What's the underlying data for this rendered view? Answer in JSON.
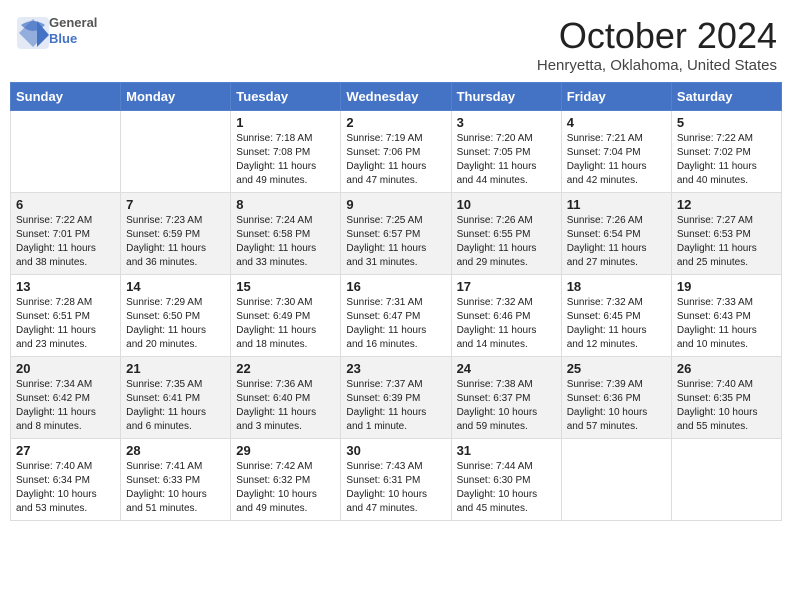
{
  "header": {
    "logo_line1": "General",
    "logo_line2": "Blue",
    "month_title": "October 2024",
    "location": "Henryetta, Oklahoma, United States"
  },
  "days_of_week": [
    "Sunday",
    "Monday",
    "Tuesday",
    "Wednesday",
    "Thursday",
    "Friday",
    "Saturday"
  ],
  "weeks": [
    [
      {
        "day": "",
        "info": ""
      },
      {
        "day": "",
        "info": ""
      },
      {
        "day": "1",
        "info": "Sunrise: 7:18 AM\nSunset: 7:08 PM\nDaylight: 11 hours and 49 minutes."
      },
      {
        "day": "2",
        "info": "Sunrise: 7:19 AM\nSunset: 7:06 PM\nDaylight: 11 hours and 47 minutes."
      },
      {
        "day": "3",
        "info": "Sunrise: 7:20 AM\nSunset: 7:05 PM\nDaylight: 11 hours and 44 minutes."
      },
      {
        "day": "4",
        "info": "Sunrise: 7:21 AM\nSunset: 7:04 PM\nDaylight: 11 hours and 42 minutes."
      },
      {
        "day": "5",
        "info": "Sunrise: 7:22 AM\nSunset: 7:02 PM\nDaylight: 11 hours and 40 minutes."
      }
    ],
    [
      {
        "day": "6",
        "info": "Sunrise: 7:22 AM\nSunset: 7:01 PM\nDaylight: 11 hours and 38 minutes."
      },
      {
        "day": "7",
        "info": "Sunrise: 7:23 AM\nSunset: 6:59 PM\nDaylight: 11 hours and 36 minutes."
      },
      {
        "day": "8",
        "info": "Sunrise: 7:24 AM\nSunset: 6:58 PM\nDaylight: 11 hours and 33 minutes."
      },
      {
        "day": "9",
        "info": "Sunrise: 7:25 AM\nSunset: 6:57 PM\nDaylight: 11 hours and 31 minutes."
      },
      {
        "day": "10",
        "info": "Sunrise: 7:26 AM\nSunset: 6:55 PM\nDaylight: 11 hours and 29 minutes."
      },
      {
        "day": "11",
        "info": "Sunrise: 7:26 AM\nSunset: 6:54 PM\nDaylight: 11 hours and 27 minutes."
      },
      {
        "day": "12",
        "info": "Sunrise: 7:27 AM\nSunset: 6:53 PM\nDaylight: 11 hours and 25 minutes."
      }
    ],
    [
      {
        "day": "13",
        "info": "Sunrise: 7:28 AM\nSunset: 6:51 PM\nDaylight: 11 hours and 23 minutes."
      },
      {
        "day": "14",
        "info": "Sunrise: 7:29 AM\nSunset: 6:50 PM\nDaylight: 11 hours and 20 minutes."
      },
      {
        "day": "15",
        "info": "Sunrise: 7:30 AM\nSunset: 6:49 PM\nDaylight: 11 hours and 18 minutes."
      },
      {
        "day": "16",
        "info": "Sunrise: 7:31 AM\nSunset: 6:47 PM\nDaylight: 11 hours and 16 minutes."
      },
      {
        "day": "17",
        "info": "Sunrise: 7:32 AM\nSunset: 6:46 PM\nDaylight: 11 hours and 14 minutes."
      },
      {
        "day": "18",
        "info": "Sunrise: 7:32 AM\nSunset: 6:45 PM\nDaylight: 11 hours and 12 minutes."
      },
      {
        "day": "19",
        "info": "Sunrise: 7:33 AM\nSunset: 6:43 PM\nDaylight: 11 hours and 10 minutes."
      }
    ],
    [
      {
        "day": "20",
        "info": "Sunrise: 7:34 AM\nSunset: 6:42 PM\nDaylight: 11 hours and 8 minutes."
      },
      {
        "day": "21",
        "info": "Sunrise: 7:35 AM\nSunset: 6:41 PM\nDaylight: 11 hours and 6 minutes."
      },
      {
        "day": "22",
        "info": "Sunrise: 7:36 AM\nSunset: 6:40 PM\nDaylight: 11 hours and 3 minutes."
      },
      {
        "day": "23",
        "info": "Sunrise: 7:37 AM\nSunset: 6:39 PM\nDaylight: 11 hours and 1 minute."
      },
      {
        "day": "24",
        "info": "Sunrise: 7:38 AM\nSunset: 6:37 PM\nDaylight: 10 hours and 59 minutes."
      },
      {
        "day": "25",
        "info": "Sunrise: 7:39 AM\nSunset: 6:36 PM\nDaylight: 10 hours and 57 minutes."
      },
      {
        "day": "26",
        "info": "Sunrise: 7:40 AM\nSunset: 6:35 PM\nDaylight: 10 hours and 55 minutes."
      }
    ],
    [
      {
        "day": "27",
        "info": "Sunrise: 7:40 AM\nSunset: 6:34 PM\nDaylight: 10 hours and 53 minutes."
      },
      {
        "day": "28",
        "info": "Sunrise: 7:41 AM\nSunset: 6:33 PM\nDaylight: 10 hours and 51 minutes."
      },
      {
        "day": "29",
        "info": "Sunrise: 7:42 AM\nSunset: 6:32 PM\nDaylight: 10 hours and 49 minutes."
      },
      {
        "day": "30",
        "info": "Sunrise: 7:43 AM\nSunset: 6:31 PM\nDaylight: 10 hours and 47 minutes."
      },
      {
        "day": "31",
        "info": "Sunrise: 7:44 AM\nSunset: 6:30 PM\nDaylight: 10 hours and 45 minutes."
      },
      {
        "day": "",
        "info": ""
      },
      {
        "day": "",
        "info": ""
      }
    ]
  ]
}
